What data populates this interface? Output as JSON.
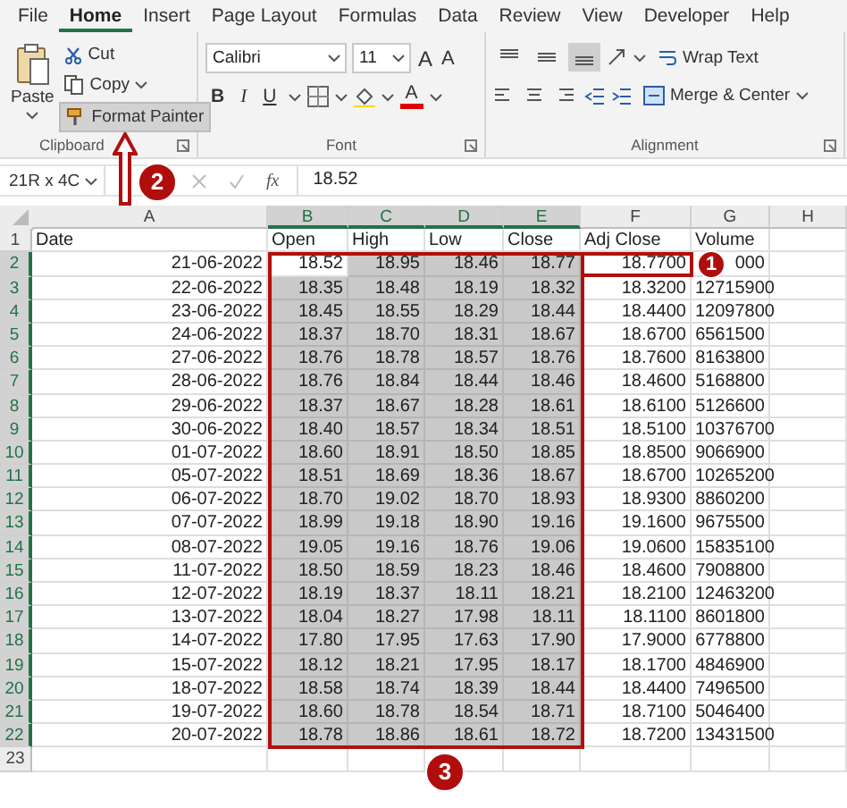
{
  "tabs": [
    {
      "label": "File",
      "selected": false
    },
    {
      "label": "Home",
      "selected": true
    },
    {
      "label": "Insert",
      "selected": false
    },
    {
      "label": "Page Layout",
      "selected": false
    },
    {
      "label": "Formulas",
      "selected": false
    },
    {
      "label": "Data",
      "selected": false
    },
    {
      "label": "Review",
      "selected": false
    },
    {
      "label": "View",
      "selected": false
    },
    {
      "label": "Developer",
      "selected": false
    },
    {
      "label": "Help",
      "selected": false
    }
  ],
  "ribbon": {
    "clipboard": {
      "title": "Clipboard",
      "paste": "Paste",
      "cut": "Cut",
      "copy": "Copy",
      "format_painter": {
        "label": "Format Painter",
        "selected": true
      }
    },
    "font": {
      "title": "Font",
      "font_name": "Calibri",
      "font_size": "11",
      "grow": "A",
      "shrink": "A",
      "bold": "B",
      "italic": "I",
      "underline": "U",
      "font_color": "A"
    },
    "alignment": {
      "title": "Alignment",
      "vertical": [
        {
          "selected": false
        },
        {
          "selected": false
        },
        {
          "selected": true
        }
      ],
      "wrap_text": "Wrap Text",
      "merge": "Merge & Center"
    }
  },
  "formula_bar": {
    "name_box": "21R x 4C",
    "fx": "fx",
    "value": "18.52"
  },
  "sheet": {
    "columns": [
      {
        "label": "A",
        "selected": false
      },
      {
        "label": "B",
        "selected": true
      },
      {
        "label": "C",
        "selected": true
      },
      {
        "label": "D",
        "selected": true
      },
      {
        "label": "E",
        "selected": true
      },
      {
        "label": "F",
        "selected": false
      },
      {
        "label": "G",
        "selected": false
      },
      {
        "label": "H",
        "selected": false
      }
    ],
    "rows": [
      {
        "header": "1",
        "selected": false,
        "cells": [
          "Date",
          "Open",
          "High",
          "Low",
          "Close",
          "Adj Close",
          "Volume"
        ]
      },
      {
        "header": "2",
        "selected": true,
        "active": true,
        "cells": [
          "21-06-2022",
          "18.52",
          "18.95",
          "18.46",
          "18.77",
          "18.7700",
          "000"
        ]
      },
      {
        "header": "3",
        "selected": true,
        "cells": [
          "22-06-2022",
          "18.35",
          "18.48",
          "18.19",
          "18.32",
          "18.3200",
          "12715900"
        ]
      },
      {
        "header": "4",
        "selected": true,
        "cells": [
          "23-06-2022",
          "18.45",
          "18.55",
          "18.29",
          "18.44",
          "18.4400",
          "12097800"
        ]
      },
      {
        "header": "5",
        "selected": true,
        "cells": [
          "24-06-2022",
          "18.37",
          "18.70",
          "18.31",
          "18.67",
          "18.6700",
          "6561500"
        ]
      },
      {
        "header": "6",
        "selected": true,
        "cells": [
          "27-06-2022",
          "18.76",
          "18.78",
          "18.57",
          "18.76",
          "18.7600",
          "8163800"
        ]
      },
      {
        "header": "7",
        "selected": true,
        "cells": [
          "28-06-2022",
          "18.76",
          "18.84",
          "18.44",
          "18.46",
          "18.4600",
          "5168800"
        ]
      },
      {
        "header": "8",
        "selected": true,
        "cells": [
          "29-06-2022",
          "18.37",
          "18.67",
          "18.28",
          "18.61",
          "18.6100",
          "5126600"
        ]
      },
      {
        "header": "9",
        "selected": true,
        "cells": [
          "30-06-2022",
          "18.40",
          "18.57",
          "18.34",
          "18.51",
          "18.5100",
          "10376700"
        ]
      },
      {
        "header": "10",
        "selected": true,
        "cells": [
          "01-07-2022",
          "18.60",
          "18.91",
          "18.50",
          "18.85",
          "18.8500",
          "9066900"
        ]
      },
      {
        "header": "11",
        "selected": true,
        "cells": [
          "05-07-2022",
          "18.51",
          "18.69",
          "18.36",
          "18.67",
          "18.6700",
          "10265200"
        ]
      },
      {
        "header": "12",
        "selected": true,
        "cells": [
          "06-07-2022",
          "18.70",
          "19.02",
          "18.70",
          "18.93",
          "18.9300",
          "8860200"
        ]
      },
      {
        "header": "13",
        "selected": true,
        "cells": [
          "07-07-2022",
          "18.99",
          "19.18",
          "18.90",
          "19.16",
          "19.1600",
          "9675500"
        ]
      },
      {
        "header": "14",
        "selected": true,
        "cells": [
          "08-07-2022",
          "19.05",
          "19.16",
          "18.76",
          "19.06",
          "19.0600",
          "15835100"
        ]
      },
      {
        "header": "15",
        "selected": true,
        "cells": [
          "11-07-2022",
          "18.50",
          "18.59",
          "18.23",
          "18.46",
          "18.4600",
          "7908800"
        ]
      },
      {
        "header": "16",
        "selected": true,
        "cells": [
          "12-07-2022",
          "18.19",
          "18.37",
          "18.11",
          "18.21",
          "18.2100",
          "12463200"
        ]
      },
      {
        "header": "17",
        "selected": true,
        "cells": [
          "13-07-2022",
          "18.04",
          "18.27",
          "17.98",
          "18.11",
          "18.1100",
          "8601800"
        ]
      },
      {
        "header": "18",
        "selected": true,
        "cells": [
          "14-07-2022",
          "17.80",
          "17.95",
          "17.63",
          "17.90",
          "17.9000",
          "6778800"
        ]
      },
      {
        "header": "19",
        "selected": true,
        "cells": [
          "15-07-2022",
          "18.12",
          "18.21",
          "17.95",
          "18.17",
          "18.1700",
          "4846900"
        ]
      },
      {
        "header": "20",
        "selected": true,
        "cells": [
          "18-07-2022",
          "18.58",
          "18.74",
          "18.39",
          "18.44",
          "18.4400",
          "7496500"
        ]
      },
      {
        "header": "21",
        "selected": true,
        "cells": [
          "19-07-2022",
          "18.60",
          "18.78",
          "18.54",
          "18.71",
          "18.7100",
          "5046400"
        ]
      },
      {
        "header": "22",
        "selected": true,
        "cells": [
          "20-07-2022",
          "18.78",
          "18.86",
          "18.61",
          "18.72",
          "18.7200",
          "13431500"
        ]
      },
      {
        "header": "23",
        "selected": false,
        "cells": []
      }
    ]
  },
  "callouts": [
    {
      "label": "1",
      "kind": "frame"
    },
    {
      "label": "2",
      "kind": "arrow"
    },
    {
      "label": "3",
      "kind": "frame"
    }
  ]
}
